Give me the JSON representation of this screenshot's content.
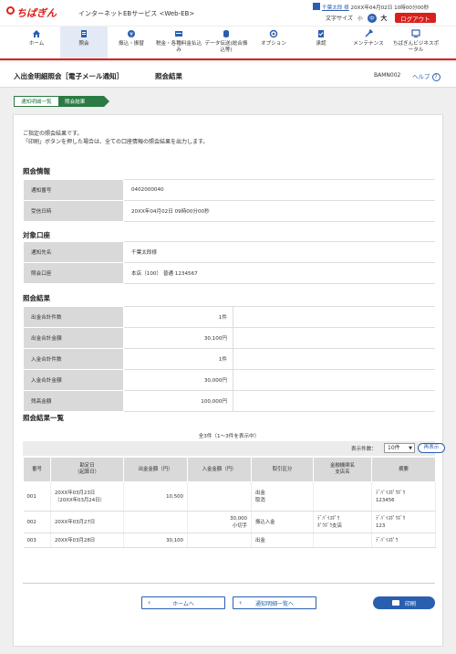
{
  "header": {
    "logo_text": "ちばぎん",
    "service_name": "インターネットEBサービス <Web-EB>",
    "user_name": "千葉太郎 様",
    "login_datetime": "20XX年04月02日 10時00分00秒",
    "font_size_label": "文字サイズ",
    "font_small": "小",
    "font_medium": "中",
    "font_large": "大",
    "logout_label": "ログアウト"
  },
  "nav": {
    "items": [
      {
        "label": "ホーム",
        "icon": "home-icon"
      },
      {
        "label": "照会",
        "icon": "inquiry-icon"
      },
      {
        "label": "振込・振替",
        "icon": "transfer-icon"
      },
      {
        "label": "税金・各種料金払込み",
        "icon": "tax-icon"
      },
      {
        "label": "データ伝送(総合振込等)",
        "icon": "data-transfer-icon"
      },
      {
        "label": "オプション",
        "icon": "option-icon"
      },
      {
        "label": "承認",
        "icon": "approval-icon"
      },
      {
        "label": "メンテナンス",
        "icon": "maintenance-icon"
      },
      {
        "label": "ちばぎんビジネスポータル",
        "icon": "portal-icon"
      }
    ]
  },
  "page": {
    "title": "入出金明細照会［電子メール通知］",
    "subtitle": "照会結果",
    "screen_id": "BAMN002",
    "help_label": "ヘルプ"
  },
  "breadcrumb": [
    "通知明細一覧",
    "照会結果"
  ],
  "intro": [
    "ご指定の照会結果です。",
    "「印刷」ボタンを押した場合は、全ての口座情報の照会結果を出力します。"
  ],
  "inquiry_info": {
    "title": "照会情報",
    "rows": [
      {
        "label": "通知番号",
        "value": "0402000040"
      },
      {
        "label": "受信日時",
        "value": "20XX年04月02日 09時00分00秒"
      }
    ]
  },
  "account": {
    "title": "対象口座",
    "rows": [
      {
        "label": "通知先名",
        "value": "千葉太郎様"
      },
      {
        "label": "照会口座",
        "value": "本店（100） 普通 1234567"
      }
    ]
  },
  "results": {
    "title": "照会結果",
    "rows": [
      {
        "label": "出金合計件数",
        "value": "1件"
      },
      {
        "label": "出金合計金額",
        "value": "30,100円"
      },
      {
        "label": "入金合計件数",
        "value": "1件"
      },
      {
        "label": "入金合計金額",
        "value": "30,000円"
      },
      {
        "label": "残高金額",
        "value": "100,000円"
      }
    ]
  },
  "list": {
    "title": "照会結果一覧",
    "count_text": "全3件（1～3件を表示中）",
    "display_count_label": "表示件数：",
    "display_count_value": "10件",
    "redisplay_label": "再表示",
    "headers": [
      "番号",
      "勘定日\n（起算日）",
      "出金金額（円）",
      "入金金額（円）",
      "取引区分",
      "金融機関名\n支店名",
      "摘要"
    ],
    "rows": [
      {
        "no": "001",
        "date": "20XX年03月23日",
        "date2": "（20XX年03月24日）",
        "out": "10,500",
        "in": "",
        "in2": "",
        "type": "出金",
        "type2": "取消",
        "bank": "",
        "bank2": "",
        "memo": "ﾃﾞﾊﾞｲｽﾎﾟｳﾎﾞｳ",
        "memo2": "123456"
      },
      {
        "no": "002",
        "date": "20XX年03月27日",
        "date2": "",
        "out": "",
        "in": "30,000",
        "in2": "小切手",
        "type": "振込入金",
        "type2": "",
        "bank": "ﾃﾞﾊﾞｲｽﾎﾟｳ",
        "bank2": "ﾎﾟｳﾎﾞｳ支店",
        "memo": "ﾃﾞﾊﾞｲｽﾎﾟｳﾎﾞｳ",
        "memo2": "123"
      },
      {
        "no": "003",
        "date": "20XX年03月28日",
        "date2": "",
        "out": "30,100",
        "in": "",
        "in2": "",
        "type": "出金",
        "type2": "",
        "bank": "",
        "bank2": "",
        "memo": "ﾃﾞﾊﾞｲｽﾎﾟｳ",
        "memo2": ""
      }
    ]
  },
  "buttons": {
    "home": "ホームへ",
    "back_list": "通知明細一覧へ",
    "print": "印刷"
  },
  "colors": {
    "brand_red": "#d8211d",
    "accent_blue": "#2a5fb0",
    "breadcrumb_green": "#2b7a43"
  }
}
